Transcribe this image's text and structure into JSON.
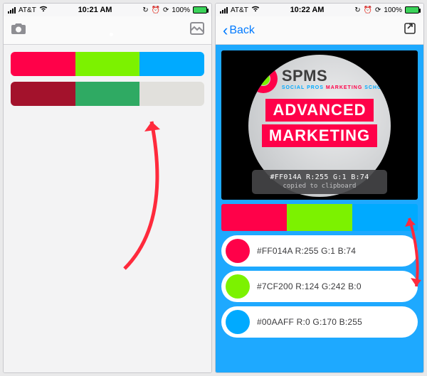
{
  "left": {
    "status": {
      "carrier": "AT&T",
      "time": "10:21 AM",
      "battery": "100%"
    },
    "palette_rows": [
      [
        "#ff0149",
        "#7cf200",
        "#00aaff"
      ],
      [
        "#a3122c",
        "#2faa63",
        "#e1e0dc"
      ]
    ]
  },
  "right": {
    "status": {
      "carrier": "AT&T",
      "time": "10:22 AM",
      "battery": "100%"
    },
    "nav": {
      "back": "Back"
    },
    "hero": {
      "brand_main": "SPMS",
      "brand_sub_left": "SOCIAL PROS",
      "brand_sub_mid": "MARKETING",
      "brand_sub_right": "SCHOOL",
      "banner_line1": "ADVANCED",
      "banner_line2": "MARKETING",
      "toast_hex": "#FF014A R:255 G:1 B:74",
      "toast_msg": "copied to clipboard"
    },
    "strip": [
      "#ff0149",
      "#7cf200",
      "#00aaff"
    ],
    "pills": [
      {
        "color": "#ff0149",
        "label": "#FF014A R:255 G:1 B:74"
      },
      {
        "color": "#7cf200",
        "label": "#7CF200 R:124 G:242 B:0"
      },
      {
        "color": "#00aaff",
        "label": "#00AAFF R:0 G:170 B:255"
      }
    ]
  }
}
